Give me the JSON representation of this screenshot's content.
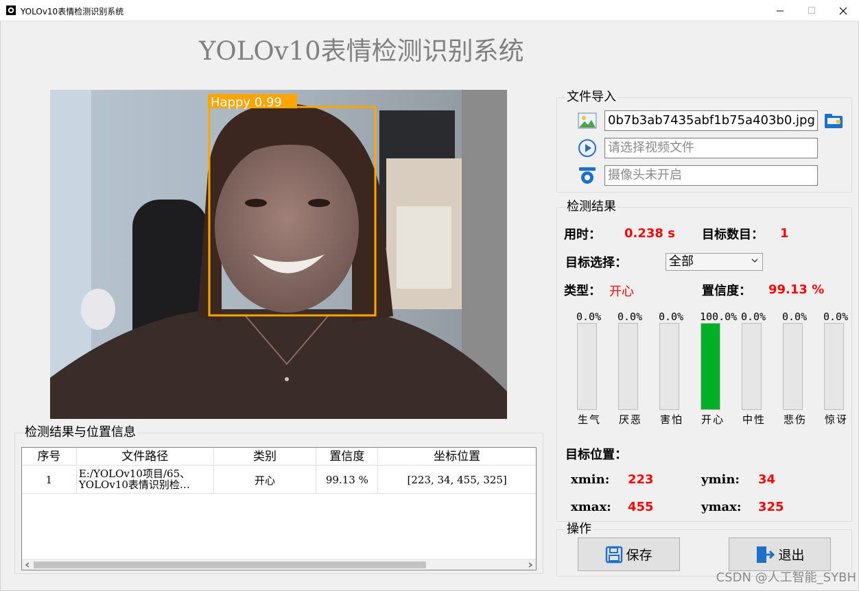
{
  "window": {
    "title": "YOLOv10表情检测识别系统"
  },
  "app": {
    "main_title": "YOLOv10表情检测识别系统"
  },
  "image": {
    "detection_label": "Happy 0.99"
  },
  "file_import": {
    "title": "文件导入",
    "image_value": "0b7b3ab7435abf1b75a403b0.jpg",
    "video_placeholder": "请选择视频文件",
    "camera_placeholder": "摄像头未开启"
  },
  "results": {
    "title": "检测结果",
    "time_label": "用时：",
    "time_value": "0.238 s",
    "count_label": "目标数目：",
    "count_value": "1",
    "select_label": "目标选择：",
    "select_value": "全部",
    "type_label": "类型：",
    "type_value": "开心",
    "conf_label": "置信度：",
    "conf_value": "99.13 %",
    "bars": [
      {
        "pct_text": "0.0%",
        "name": "生气",
        "value": 0.0
      },
      {
        "pct_text": "0.0%",
        "name": "厌恶",
        "value": 0.0
      },
      {
        "pct_text": "0.0%",
        "name": "害怕",
        "value": 0.0
      },
      {
        "pct_text": "100.0%",
        "name": "开心",
        "value": 100.0
      },
      {
        "pct_text": "0.0%",
        "name": "中性",
        "value": 0.0
      },
      {
        "pct_text": "0.0%",
        "name": "悲伤",
        "value": 0.0
      },
      {
        "pct_text": "0.0%",
        "name": "惊讶",
        "value": 0.0
      }
    ],
    "position_label": "目标位置：",
    "xmin_label": "xmin:",
    "xmin_value": "223",
    "ymin_label": "ymin:",
    "ymin_value": "34",
    "xmax_label": "xmax:",
    "xmax_value": "455",
    "ymax_label": "ymax:",
    "ymax_value": "325"
  },
  "operations": {
    "title": "操作",
    "save_label": "保存",
    "exit_label": "退出"
  },
  "table": {
    "title": "检测结果与位置信息",
    "headers": [
      "序号",
      "文件路径",
      "类别",
      "置信度",
      "坐标位置"
    ],
    "rows": [
      {
        "index": "1",
        "path": "E:/YOLOv10项目/65、YOLOv10表情识别检…",
        "class": "开心",
        "confidence": "99.13 %",
        "coords": "[223, 34, 455, 325]"
      }
    ]
  },
  "watermark": "CSDN @人工智能_SYBH",
  "colors": {
    "accent_red": "#ff0000",
    "bar_green": "#00b026",
    "box_orange": "#ffa500"
  }
}
